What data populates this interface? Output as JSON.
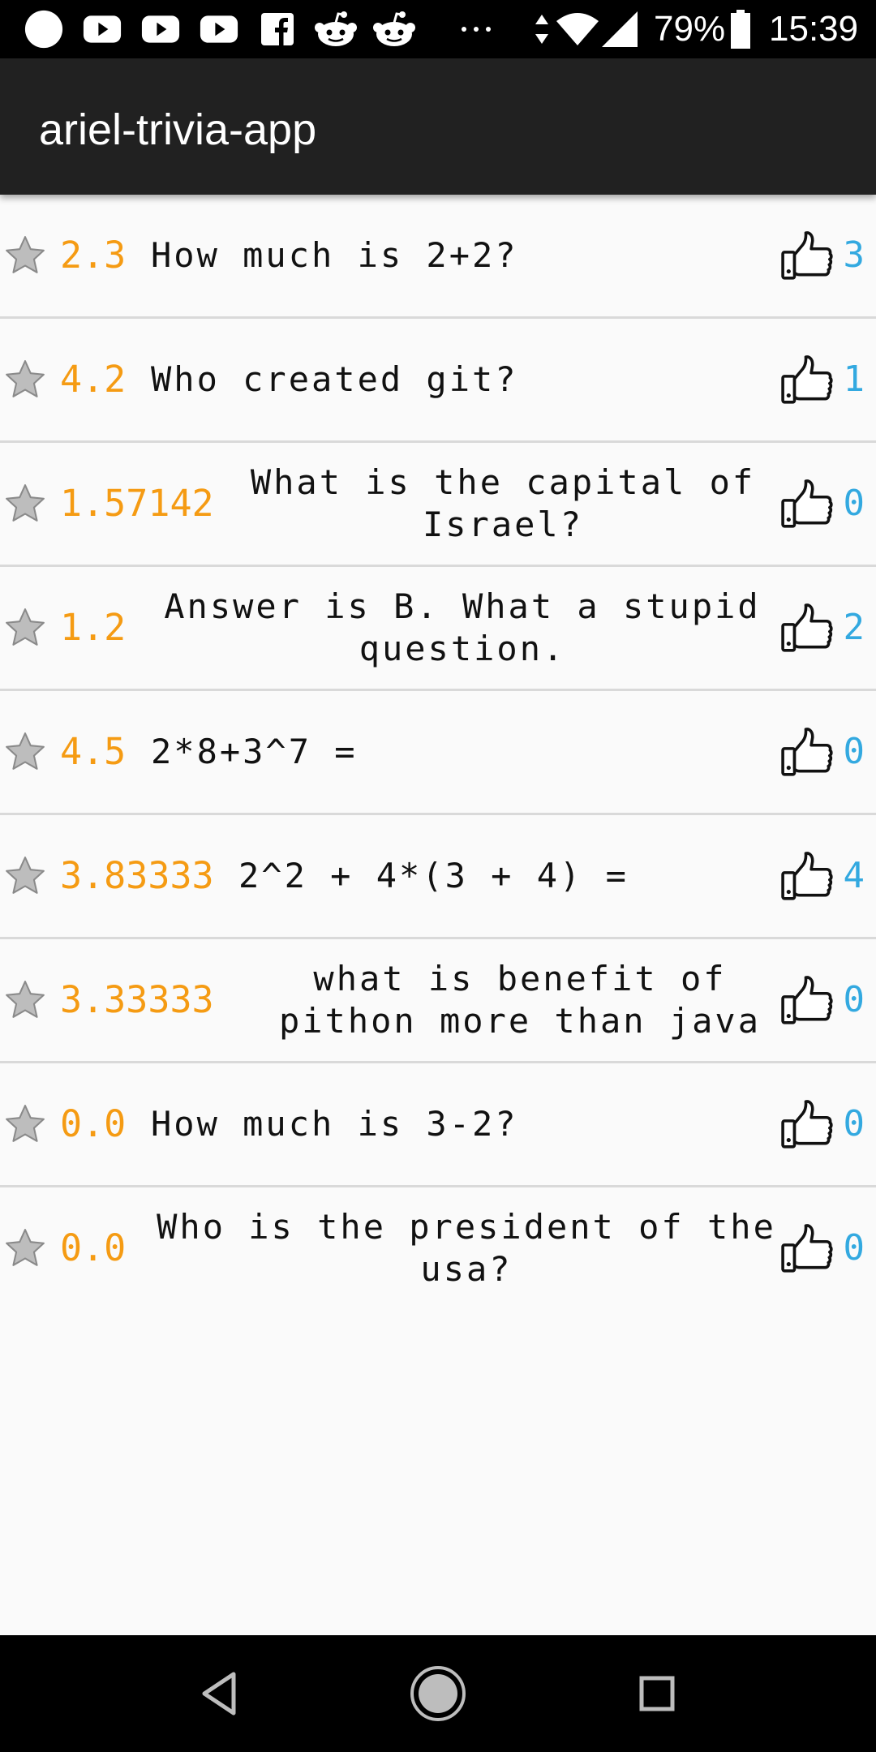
{
  "status_bar": {
    "battery_percent": "79%",
    "time": "15:39",
    "notification_icons": [
      "circle-icon",
      "youtube-icon",
      "youtube-icon",
      "youtube-icon",
      "facebook-icon",
      "reddit-icon",
      "reddit-icon",
      "more-icon"
    ],
    "system_icons": [
      "data-arrows-icon",
      "wifi-icon",
      "signal-icon",
      "battery-icon"
    ]
  },
  "app_bar": {
    "title": "ariel-trivia-app"
  },
  "colors": {
    "rating": "#f59b13",
    "like_count": "#33a9e0",
    "app_bar": "#212121",
    "background": "#fafafa",
    "divider": "#d9d9d9"
  },
  "questions": [
    {
      "rating": "2.3",
      "text": "How much is 2+2?",
      "likes": "3"
    },
    {
      "rating": "4.2",
      "text": "Who created git?",
      "likes": "1"
    },
    {
      "rating": "1.57142",
      "text": "What is the capital of Israel?",
      "likes": "0"
    },
    {
      "rating": "1.2",
      "text": "Answer is B. What a stupid question.",
      "likes": "2"
    },
    {
      "rating": "4.5",
      "text": "2*8+3^7 =",
      "likes": "0"
    },
    {
      "rating": "3.83333",
      "text": "2^2 + 4*(3 + 4) =",
      "likes": "4"
    },
    {
      "rating": "3.33333",
      "text": "what is benefit of pithon more than java",
      "likes": "0"
    },
    {
      "rating": "0.0",
      "text": "How much is 3-2?",
      "likes": "0"
    },
    {
      "rating": "0.0",
      "text": "Who is the president of the usa?",
      "likes": "0"
    }
  ],
  "row_icons": {
    "rating": "star-icon",
    "likes": "thumbs-up-icon"
  },
  "nav_bar": {
    "buttons": [
      "back-icon",
      "home-icon",
      "recents-icon"
    ]
  }
}
